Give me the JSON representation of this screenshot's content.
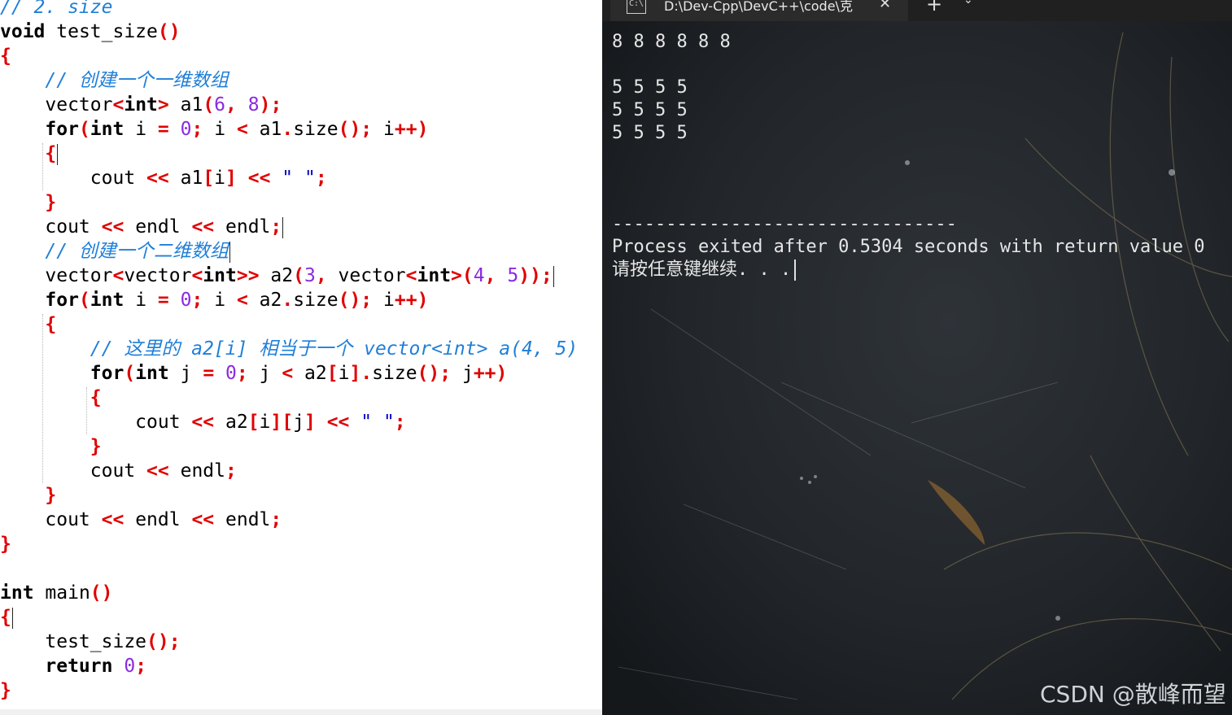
{
  "editor": {
    "comment_size": "// 2. size",
    "func_name": "test_size",
    "comment_1d": "// 创建一个一维数组",
    "comment_2d": "// 创建一个二维数组",
    "comment_inner": "// 这里的 a2[i] 相当于一个 vector<int> a(4, 5)",
    "main_name": "main",
    "call_test_size": "test_size",
    "space_str": "\" \""
  },
  "terminal": {
    "tab_title": "D:\\Dev-Cpp\\DevC++\\code\\克",
    "tab_icon_text": "C:\\",
    "close_glyph": "✕",
    "new_tab_glyph": "+",
    "dropdown_glyph": "⌄",
    "output_lines": [
      "8 8 8 8 8 8",
      "",
      "5 5 5 5",
      "5 5 5 5",
      "5 5 5 5"
    ],
    "separator": "--------------------------------",
    "process_exit": "Process exited after 0.5304 seconds with return value 0",
    "press_any_key": "请按任意键继续. . ."
  },
  "watermark": "CSDN @散峰而望",
  "colors": {
    "keyword": "#000000",
    "punctuation": "#e00000",
    "number": "#8a2be2",
    "comment": "#1f7fd8",
    "string": "#0000c8",
    "terminal_bg": "#1f2226",
    "terminal_text": "#e6e6e6"
  }
}
